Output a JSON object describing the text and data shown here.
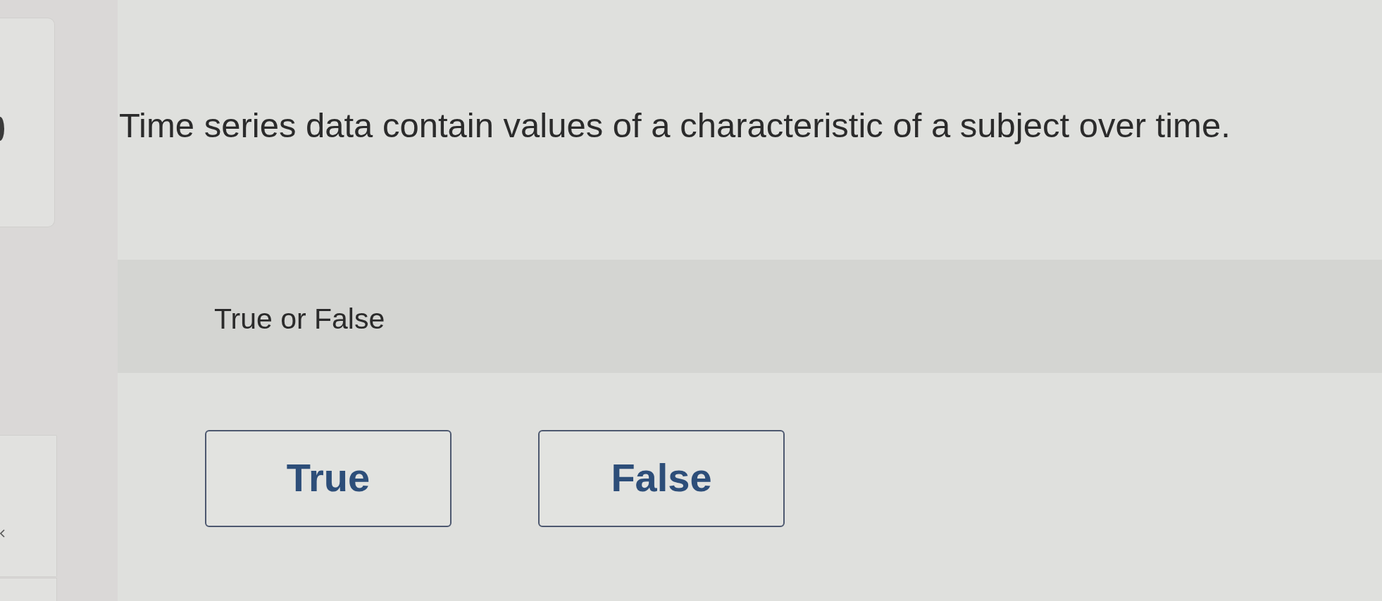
{
  "question": {
    "text": "Time series data contain values of a characteristic of a subject over time."
  },
  "prompt": {
    "text": "True or False"
  },
  "answers": [
    {
      "label": "True",
      "selected": false
    },
    {
      "label": "False",
      "selected": false
    }
  ]
}
